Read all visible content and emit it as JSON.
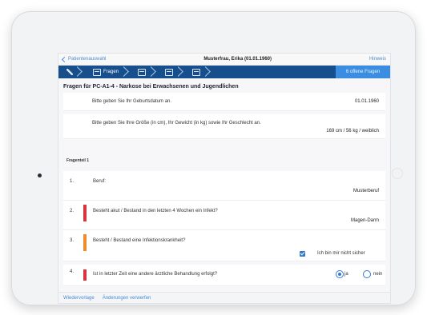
{
  "app": {
    "back_label": "Patientenauswahl",
    "title": "Musterfrau, Erika (01.01.1960)",
    "hint_label": "Hinweis"
  },
  "steps": [
    {
      "label": "",
      "icon": "syringe-icon"
    },
    {
      "label": "Fragen",
      "icon": "document-icon"
    },
    {
      "label": "",
      "icon": "document-icon"
    },
    {
      "label": "",
      "icon": "document-icon"
    },
    {
      "label": "",
      "icon": "document-icon"
    }
  ],
  "open_questions": "6 offene Fragen",
  "section_title": "Fragen für PC-A1-4 - Narkose bei Erwachsenen und Jugendlichen",
  "general": [
    {
      "question": "Bitte geben Sie Ihr Geburtsdatum an.",
      "answer": "01.01.1960"
    },
    {
      "question": "Bitte geben Sie Ihre Größe (in cm), Ihr Gewicht (in kg) sowie Ihr Geschlecht an.",
      "answer": "169 cm / 56 kg / weiblich"
    }
  ],
  "part_heading": "Fragenteil 1",
  "questions": [
    {
      "num": "1.",
      "text": "Beruf:",
      "answer": "Musterberuf",
      "color": ""
    },
    {
      "num": "2.",
      "text": "Besteht akut / Bestand in den letzten 4 Wochen ein Infekt?",
      "answer": "Magen-Darm",
      "color": "#d8343f"
    },
    {
      "num": "3.",
      "text": "Besteht / Bestand eine Infektionskrankheit?",
      "check_label": "Ich bin mir nicht sicher",
      "color": "#ef8a2d"
    },
    {
      "num": "4.",
      "text": "Ist in letzter Zeit eine andere ärztliche Behandlung erfolgt?",
      "yes": "ja",
      "no": "nein",
      "color": "#d8343f"
    }
  ],
  "footer": {
    "resubmit": "Wiedervorlage",
    "discard": "Änderungen verwerfen"
  }
}
